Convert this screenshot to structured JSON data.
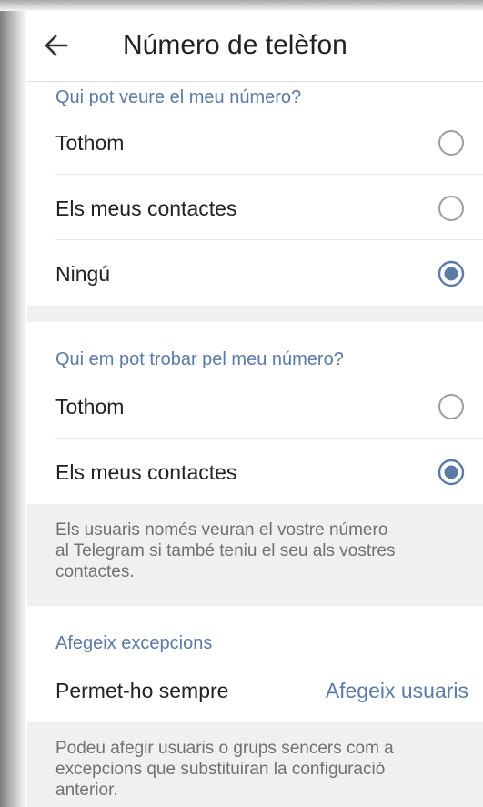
{
  "header": {
    "title": "Número de telèfon",
    "back_icon": "arrow-left-icon"
  },
  "section1": {
    "title": "Qui pot veure el meu número?",
    "options": [
      {
        "label": "Tothom",
        "selected": false
      },
      {
        "label": "Els meus contactes",
        "selected": false
      },
      {
        "label": "Ningú",
        "selected": true
      }
    ]
  },
  "section2": {
    "title": "Qui em pot trobar pel meu número?",
    "options": [
      {
        "label": "Tothom",
        "selected": false
      },
      {
        "label": "Els meus contactes",
        "selected": true
      }
    ],
    "info_line1": "Els usuaris només veuran el vostre número",
    "info_line2": "al Telegram si també teniu el seu als vostres",
    "info_line3": "contactes."
  },
  "section3": {
    "title": "Afegeix excepcions",
    "row_label": "Permet-ho sempre",
    "row_action": "Afegeix usuaris",
    "info_line1": "Podeu afegir usuaris o grups sencers com a",
    "info_line2": "excepcions que substituiran la configuració",
    "info_line3": "anterior."
  },
  "colors": {
    "accent": "#5b7ba6",
    "text": "#222222",
    "secondary_text": "#707070",
    "gray_background": "#f0f0f0",
    "radio_unselected": "#9e9e9e",
    "radio_selected": "#5b7ba6"
  }
}
